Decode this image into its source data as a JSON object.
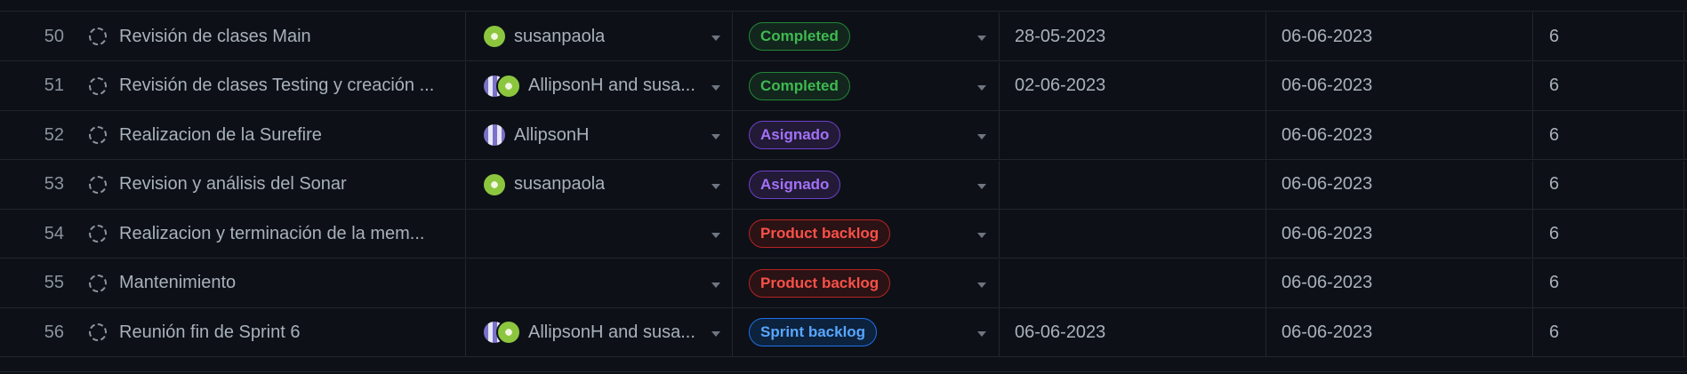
{
  "colors": {
    "background": "#0d1117",
    "border": "#21262d",
    "completed": "#3fb950",
    "asignado": "#a371f7",
    "product_backlog": "#f85149",
    "sprint_backlog": "#58a6ff"
  },
  "rows": [
    {
      "num": "50",
      "title": "Revisión de clases Main",
      "avatars": [
        "susanpaola"
      ],
      "assignee": "susanpaola",
      "status": "Completed",
      "status_kind": "completed",
      "start": "28-05-2023",
      "end": "06-06-2023",
      "sprint": "6"
    },
    {
      "num": "51",
      "title": "Revisión de clases Testing y creación ...",
      "avatars": [
        "AllipsonH",
        "susanpaola"
      ],
      "assignee": "AllipsonH and susa...",
      "status": "Completed",
      "status_kind": "completed",
      "start": "02-06-2023",
      "end": "06-06-2023",
      "sprint": "6"
    },
    {
      "num": "52",
      "title": "Realizacion de la Surefire",
      "avatars": [
        "AllipsonH"
      ],
      "assignee": "AllipsonH",
      "status": "Asignado",
      "status_kind": "asignado",
      "start": "",
      "end": "06-06-2023",
      "sprint": "6"
    },
    {
      "num": "53",
      "title": "Revision y análisis del Sonar",
      "avatars": [
        "susanpaola"
      ],
      "assignee": "susanpaola",
      "status": "Asignado",
      "status_kind": "asignado",
      "start": "",
      "end": "06-06-2023",
      "sprint": "6"
    },
    {
      "num": "54",
      "title": "Realizacion y terminación de la mem...",
      "avatars": [],
      "assignee": "",
      "status": "Product backlog",
      "status_kind": "backlog",
      "start": "",
      "end": "06-06-2023",
      "sprint": "6"
    },
    {
      "num": "55",
      "title": "Mantenimiento",
      "avatars": [],
      "assignee": "",
      "status": "Product backlog",
      "status_kind": "backlog",
      "start": "",
      "end": "06-06-2023",
      "sprint": "6"
    },
    {
      "num": "56",
      "title": "Reunión fin de Sprint 6",
      "avatars": [
        "AllipsonH",
        "susanpaola"
      ],
      "assignee": "AllipsonH and susa...",
      "status": "Sprint backlog",
      "status_kind": "sprint",
      "start": "06-06-2023",
      "end": "06-06-2023",
      "sprint": "6"
    }
  ]
}
